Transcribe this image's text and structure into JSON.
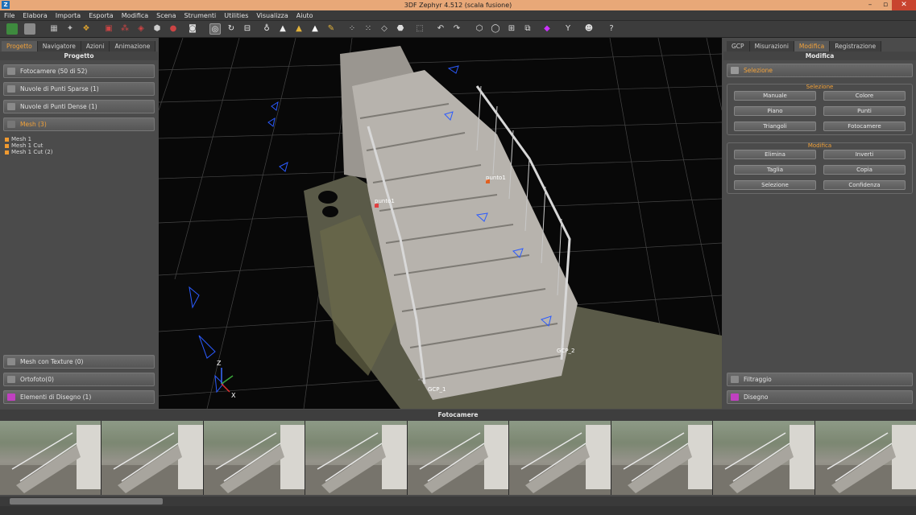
{
  "window": {
    "title": "3DF Zephyr 4.512 (scala fusione)",
    "icon_letter": "Z",
    "minimize": "–",
    "maximize": "▫",
    "close": "✕"
  },
  "menu": [
    "File",
    "Elabora",
    "Importa",
    "Esporta",
    "Modifica",
    "Scena",
    "Strumenti",
    "Utilities",
    "Visualizza",
    "Aiuto"
  ],
  "toolbar_icons": [
    "open-icon",
    "save-icon",
    "sparse-icon",
    "dense-icon",
    "mesh-icon",
    "texture-icon",
    "camera-red-icon",
    "cloud-red-icon",
    "mesh-red-icon",
    "brush-icon",
    "sphere-icon",
    "snapshot-icon",
    "orbit-icon",
    "rotate-icon",
    "pan-icon",
    "light-icon",
    "triangle-icon",
    "triangle-gold-icon",
    "triangle-white-icon",
    "paint-icon",
    "points-icon",
    "points-alt-icon",
    "cube-icon",
    "cube-solid-icon",
    "bbox-icon",
    "undo-icon",
    "redo-icon",
    "select-poly-icon",
    "lasso-icon",
    "stamp-icon",
    "layers-icon",
    "fill-icon",
    "caliper-icon",
    "mask-icon",
    "help-icon"
  ],
  "left": {
    "tabs": [
      "Progetto",
      "Navigatore",
      "Azioni",
      "Animazione"
    ],
    "header": "Progetto",
    "items": [
      {
        "label": "Fotocamere (50 di 52)"
      },
      {
        "label": "Nuvole di Punti Sparse (1)"
      },
      {
        "label": "Nuvole di Punti Dense (1)"
      },
      {
        "label": "Mesh (3)"
      }
    ],
    "mesh_tree": [
      "Mesh 1",
      "Mesh 1 Cut",
      "Mesh 1 Cut (2)"
    ],
    "bottom_items": [
      {
        "label": "Mesh con Texture (0)"
      },
      {
        "label": "Ortofoto(0)"
      },
      {
        "label": "Elementi di Disegno (1)"
      }
    ]
  },
  "right": {
    "tabs": [
      "GCP",
      "Misurazioni",
      "Modifica",
      "Registrazione"
    ],
    "header": "Modifica",
    "section_button": "Selezione",
    "selezione_group": {
      "title": "Selezione",
      "buttons": [
        "Manuale",
        "Colore",
        "Piano",
        "Punti",
        "Triangoli",
        "Fotocamere"
      ]
    },
    "modifica_group": {
      "title": "Modifica",
      "buttons": [
        "Elimina",
        "Inverti",
        "Taglia",
        "Copia",
        "Selezione",
        "Confidenza"
      ]
    },
    "filtraggio": "Filtraggio",
    "disegno": "Disegno"
  },
  "viewport": {
    "labels": {
      "punto1": "punto1",
      "punto2": "punto1",
      "gcp1": "GCP_1",
      "gcp2": "GCP_2",
      "axis_z": "Z",
      "axis_x": "X"
    }
  },
  "strip": {
    "title": "Fotocamere",
    "count": 9
  },
  "colors": {
    "accent": "#f2a23a",
    "title_bg": "#e8a878",
    "close": "#c8442f"
  }
}
